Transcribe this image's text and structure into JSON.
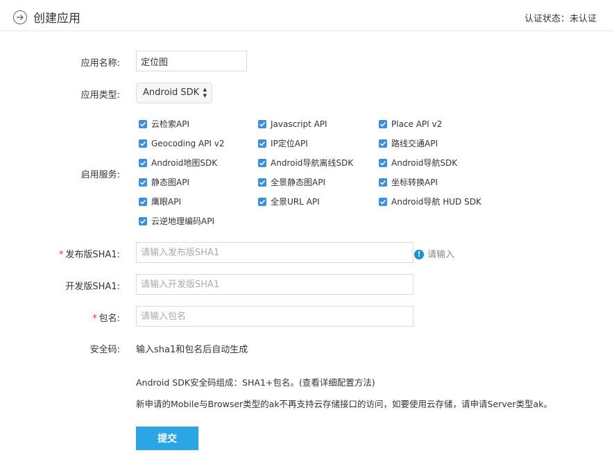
{
  "header": {
    "title": "创建应用",
    "auth_status": "认证状态：未认证"
  },
  "form": {
    "app_name": {
      "label": "应用名称:",
      "value": "定位图"
    },
    "app_type": {
      "label": "应用类型:",
      "value": "Android SDK"
    },
    "services": {
      "label": "启用服务:",
      "items": [
        {
          "label": "云检索API",
          "checked": true
        },
        {
          "label": "Javascript API",
          "checked": true
        },
        {
          "label": "Place API v2",
          "checked": true
        },
        {
          "label": "Geocoding API v2",
          "checked": true
        },
        {
          "label": "IP定位API",
          "checked": true
        },
        {
          "label": "路线交通API",
          "checked": true
        },
        {
          "label": "Android地图SDK",
          "checked": true
        },
        {
          "label": "Android导航离线SDK",
          "checked": true
        },
        {
          "label": "Android导航SDK",
          "checked": true
        },
        {
          "label": "静态图API",
          "checked": true
        },
        {
          "label": "全景静态图API",
          "checked": true
        },
        {
          "label": "坐标转换API",
          "checked": true
        },
        {
          "label": "鹰眼API",
          "checked": true
        },
        {
          "label": "全景URL API",
          "checked": true
        },
        {
          "label": "Android导航 HUD SDK",
          "checked": true
        },
        {
          "label": "云逆地理编码API",
          "checked": true
        }
      ]
    },
    "release_sha1": {
      "required_mark": "*",
      "label": "发布版SHA1:",
      "placeholder": "请输入发布版SHA1",
      "value": "",
      "hint": "请输入"
    },
    "dev_sha1": {
      "label": "开发版SHA1:",
      "placeholder": "请输入开发版SHA1",
      "value": ""
    },
    "package": {
      "required_mark": "*",
      "label": "包名:",
      "placeholder": "请输入包名",
      "value": ""
    },
    "security_code": {
      "label": "安全码:",
      "value": "输入sha1和包名后自动生成"
    },
    "note1": "Android SDK安全码组成：SHA1+包名。(查看详细配置方法)",
    "note2": "新申请的Mobile与Browser类型的ak不再支持云存储接口的访问，如要使用云存储，请申请Server类型ak。",
    "submit_label": "提交"
  },
  "colors": {
    "accent": "#2aa6e5",
    "checkbox": "#3b8fe0",
    "required": "#e4393c",
    "warning_icon": "#1a8fd6"
  }
}
